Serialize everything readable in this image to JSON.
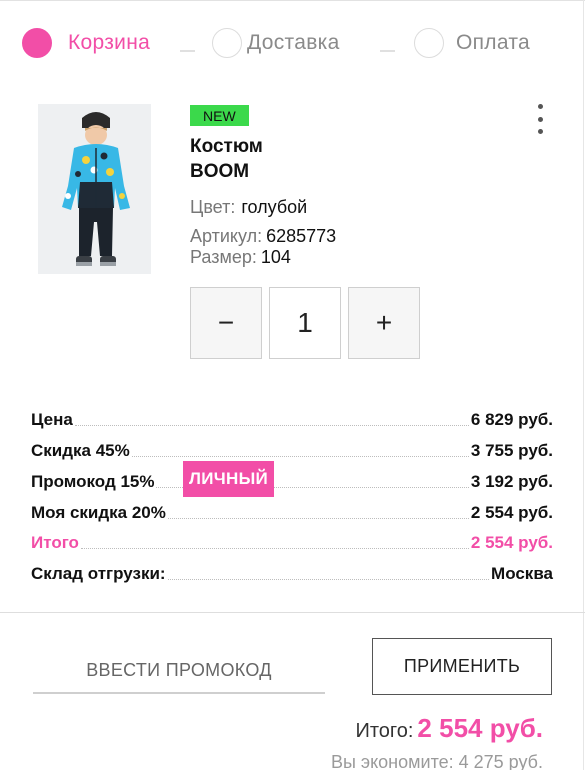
{
  "steps": [
    {
      "label": "Корзина",
      "active": true
    },
    {
      "label": "Доставка",
      "active": false
    },
    {
      "label": "Оплата",
      "active": false
    }
  ],
  "product": {
    "badge": "NEW",
    "title_line1": "Костюм",
    "title_line2": "BOOM",
    "color_label": "Цвет:",
    "color_value": "голубой",
    "article_label": "Артикул:",
    "article_value": "6285773",
    "size_label": "Размер:",
    "size_value": "104",
    "image_icon": "child-winter-suit-photo",
    "menu_icon": "more-vertical-icon"
  },
  "quantity": {
    "minus": "−",
    "value": "1",
    "plus": "+"
  },
  "prices": {
    "price_label": "Цена",
    "price_value": "6 829 руб.",
    "discount_label": "Скидка 45%",
    "discount_value": "3 755 руб.",
    "promo_label": "Промокод 15%",
    "promo_tag": "ЛИЧНЫЙ",
    "promo_value": "3 192 руб.",
    "my_discount_label": "Моя скидка 20%",
    "my_discount_value": "2 554 руб.",
    "total_label": "Итого",
    "total_value": "2 554 руб.",
    "warehouse_label": "Склад отгрузки:",
    "warehouse_value": "Москва"
  },
  "promo": {
    "input_placeholder": "ВВЕСТИ ПРОМОКОД",
    "apply_label": "ПРИМЕНИТЬ"
  },
  "summary": {
    "total_label": "Итого:",
    "total_value": "2 554 руб.",
    "savings": "Вы экономите: 4 275 руб."
  },
  "colors": {
    "accent": "#f24ea7",
    "badge": "#3bd94b"
  }
}
